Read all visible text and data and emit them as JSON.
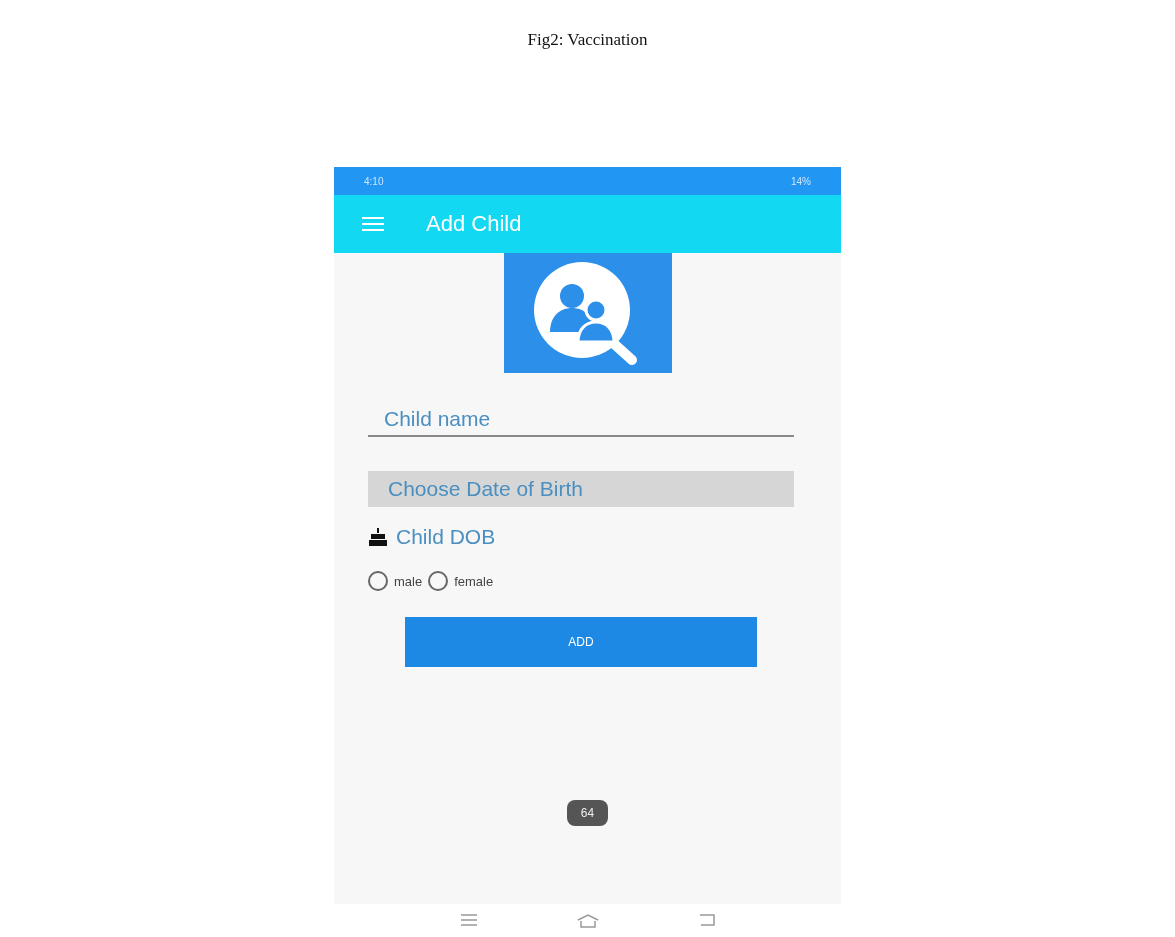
{
  "caption": "Fig2: Vaccination",
  "status_bar": {
    "time": "4:10",
    "battery": "14%"
  },
  "app_bar": {
    "title": "Add Child"
  },
  "form": {
    "name_field": {
      "placeholder": "Child name"
    },
    "date_button": "Choose Date of Birth",
    "dob_label": "Child DOB",
    "gender": [
      {
        "label": "male",
        "selected": false
      },
      {
        "label": "female",
        "selected": false
      }
    ],
    "add_button": "ADD"
  },
  "toast": "64"
}
